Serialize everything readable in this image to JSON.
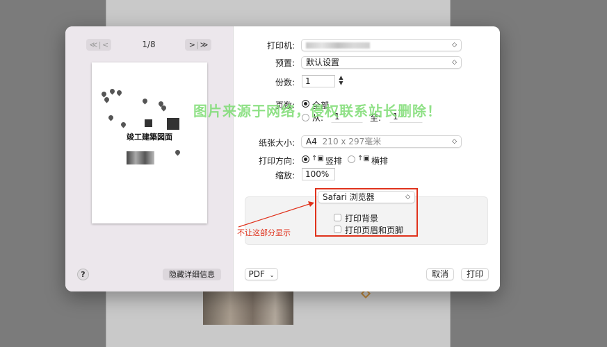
{
  "background": {
    "sheet_color": "#c9c9c9"
  },
  "sidebar": {
    "nav": {
      "first": "≪",
      "prev": "<",
      "next": ">",
      "last": "≫"
    },
    "page_indicator": "1/8",
    "preview_title": "竣工建築図面",
    "help_label": "?",
    "hide_details_label": "隐藏详细信息"
  },
  "settings": {
    "printer": {
      "label": "打印机:",
      "value": ""
    },
    "preset": {
      "label": "预置:",
      "value": "默认设置"
    },
    "copies": {
      "label": "份数:",
      "value": "1"
    },
    "pages": {
      "label": "页数:",
      "all_label": "全部",
      "from_label": "从:",
      "from_value": "1",
      "to_label": "至:",
      "to_value": "1"
    },
    "paper_size": {
      "label": "纸张大小:",
      "value": "A4",
      "dims": "210 x 297毫米"
    },
    "orientation": {
      "label": "打印方向:",
      "portrait_label": "竖排",
      "landscape_label": "横排"
    },
    "scale": {
      "label": "缩放:",
      "value": "100%"
    },
    "app_section": {
      "selected": "Safari 浏览器",
      "options": [
        "打印背景",
        "打印页眉和页脚"
      ]
    }
  },
  "annotation": {
    "text": "不让这部分显示",
    "color": "#e0321c"
  },
  "footer": {
    "pdf_label": "PDF",
    "cancel_label": "取消",
    "print_label": "打印"
  },
  "watermark": {
    "text": "图片来源于网络，侵权联系站长删除！",
    "color": "#7ddc73"
  }
}
